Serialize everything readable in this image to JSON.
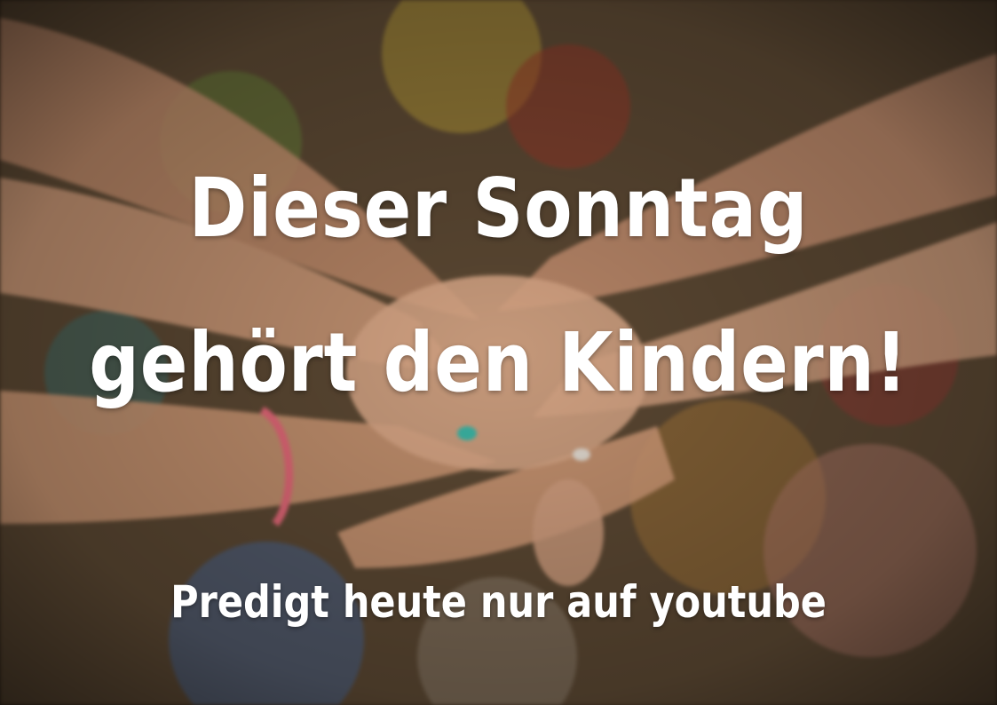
{
  "headline": {
    "line1": "Dieser Sonntag",
    "line2": "gehört den Kindern!"
  },
  "subline": "Predigt heute nur auf youtube",
  "colors": {
    "text": "#ffffff",
    "skin": "#d8a07a",
    "bracelet": "#e86a7a",
    "nail": "#3cb8a8"
  }
}
